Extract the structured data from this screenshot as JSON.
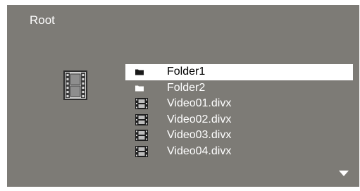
{
  "browser": {
    "path_title": "Root",
    "preview_icon": "film-strip-icon",
    "items": [
      {
        "label": "Folder1",
        "type": "folder",
        "icon": "folder-icon",
        "selected": true
      },
      {
        "label": "Folder2",
        "type": "folder",
        "icon": "folder-icon",
        "selected": false
      },
      {
        "label": "Video01.divx",
        "type": "video",
        "icon": "film-strip-icon",
        "selected": false
      },
      {
        "label": "Video02.divx",
        "type": "video",
        "icon": "film-strip-icon",
        "selected": false
      },
      {
        "label": "Video03.divx",
        "type": "video",
        "icon": "film-strip-icon",
        "selected": false
      },
      {
        "label": "Video04.divx",
        "type": "video",
        "icon": "film-strip-icon",
        "selected": false
      }
    ],
    "scroll_indicator": "scroll-down-arrow-icon"
  },
  "colors": {
    "background": "#7d7b76",
    "text": "#ffffff",
    "selection_background": "#ffffff",
    "selection_text": "#000000"
  }
}
